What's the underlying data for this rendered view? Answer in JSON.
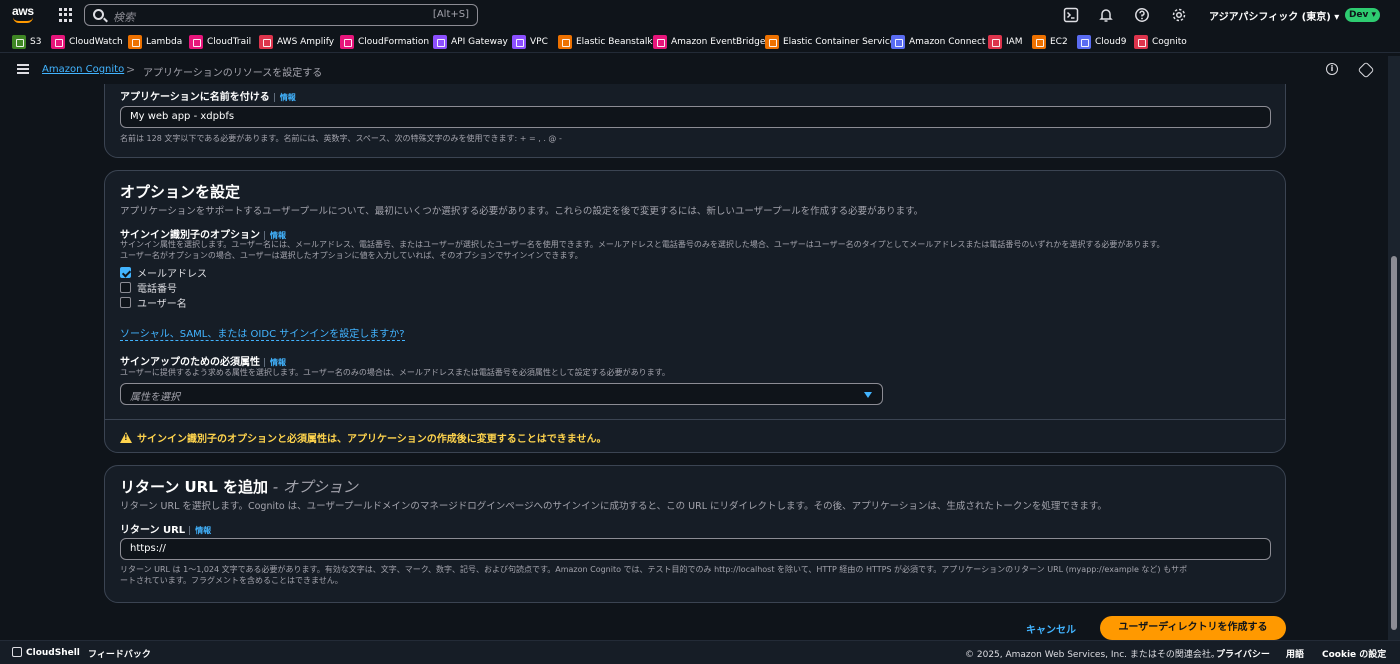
{
  "topnav": {
    "logo_text": "aws",
    "search_placeholder": "検索",
    "search_shortcut": "[Alt+S]",
    "region": "アジアパシフィック (東京) ▾",
    "account_badge": "Dev ▾"
  },
  "favorites": [
    {
      "label": "S3",
      "color": "#3f8624"
    },
    {
      "label": "CloudWatch",
      "color": "#e7157b"
    },
    {
      "label": "Lambda",
      "color": "#ed7100"
    },
    {
      "label": "CloudTrail",
      "color": "#e7157b"
    },
    {
      "label": "AWS Amplify",
      "color": "#dd344c"
    },
    {
      "label": "CloudFormation",
      "color": "#e7157b"
    },
    {
      "label": "API Gateway",
      "color": "#8c4fff"
    },
    {
      "label": "VPC",
      "color": "#8c4fff"
    },
    {
      "label": "Elastic Beanstalk",
      "color": "#ed7100"
    },
    {
      "label": "Amazon EventBridge",
      "color": "#e7157b"
    },
    {
      "label": "Elastic Container Service",
      "color": "#ed7100"
    },
    {
      "label": "Amazon Connect",
      "color": "#5a6cf2"
    },
    {
      "label": "IAM",
      "color": "#dd344c"
    },
    {
      "label": "EC2",
      "color": "#ed7100"
    },
    {
      "label": "Cloud9",
      "color": "#5a6cf2"
    },
    {
      "label": "Cognito",
      "color": "#dd344c"
    }
  ],
  "breadcrumb": {
    "link": "Amazon Cognito",
    "separator": ">",
    "current": "アプリケーションのリソースを設定する"
  },
  "app_name": {
    "label": "アプリケーションに名前を付ける",
    "info": "情報",
    "value": "My web app - xdpbfs",
    "help": "名前は 128 文字以下である必要があります。名前には、英数字、スペース、次の特殊文字のみを使用できます: + = , . @ -"
  },
  "options": {
    "title": "オプションを設定",
    "description": "アプリケーションをサポートするユーザープールについて、最初にいくつか選択する必要があります。これらの設定を後で変更するには、新しいユーザープールを作成する必要があります。",
    "signin_label": "サインイン識別子のオプション",
    "signin_info": "情報",
    "signin_help_1": "サインイン属性を選択します。ユーザー名には、メールアドレス、電話番号、またはユーザーが選択したユーザー名を使用できます。メールアドレスと電話番号のみを選択した場合、ユーザーはユーザー名のタイプとしてメールアドレスまたは電話番号のいずれかを選択する必要があります。",
    "signin_help_2": "ユーザー名がオプションの場合、ユーザーは選択したオプションに値を入力していれば、そのオプションでサインインできます。",
    "checkboxes": [
      {
        "label": "メールアドレス",
        "checked": true
      },
      {
        "label": "電話番号",
        "checked": false
      },
      {
        "label": "ユーザー名",
        "checked": false
      }
    ],
    "social_link": "ソーシャル、SAML、または OIDC サインインを設定しますか?",
    "signup_label": "サインアップのための必須属性",
    "signup_info": "情報",
    "signup_help": "ユーザーに提供するよう求める属性を選択します。ユーザー名のみの場合は、メールアドレスまたは電話番号を必須属性として設定する必要があります。",
    "select_placeholder": "属性を選択",
    "warning": "サインイン識別子のオプションと必須属性は、アプリケーションの作成後に変更することはできません。"
  },
  "return_url": {
    "title": "リターン URL を追加",
    "title_optional": " - オプション",
    "description": "リターン URL を選択します。Cognito は、ユーザープールドメインのマネージドログインページへのサインインに成功すると、この URL にリダイレクトします。その後、アプリケーションは、生成されたトークンを処理できます。",
    "label": "リターン URL",
    "info": "情報",
    "value": "https://",
    "help_1": "リターン URL は 1〜1,024 文字である必要があります。有効な文字は、文字、マーク、数字、記号、および句読点です。Amazon Cognito では、テスト目的でのみ http://localhost を除いて、HTTP 経由の HTTPS が必須です。アプリケーションのリターン URL (myapp://example など) もサポ",
    "help_2": "ートされています。フラグメントを含めることはできません。"
  },
  "actions": {
    "cancel": "キャンセル",
    "create": "ユーザーディレクトリを作成する"
  },
  "footer": {
    "cloudshell": "CloudShell",
    "feedback": "フィードバック",
    "copyright": "© 2025, Amazon Web Services, Inc. またはその関連会社。",
    "privacy": "プライバシー",
    "terms": "用語",
    "cookie": "Cookie の設定"
  }
}
